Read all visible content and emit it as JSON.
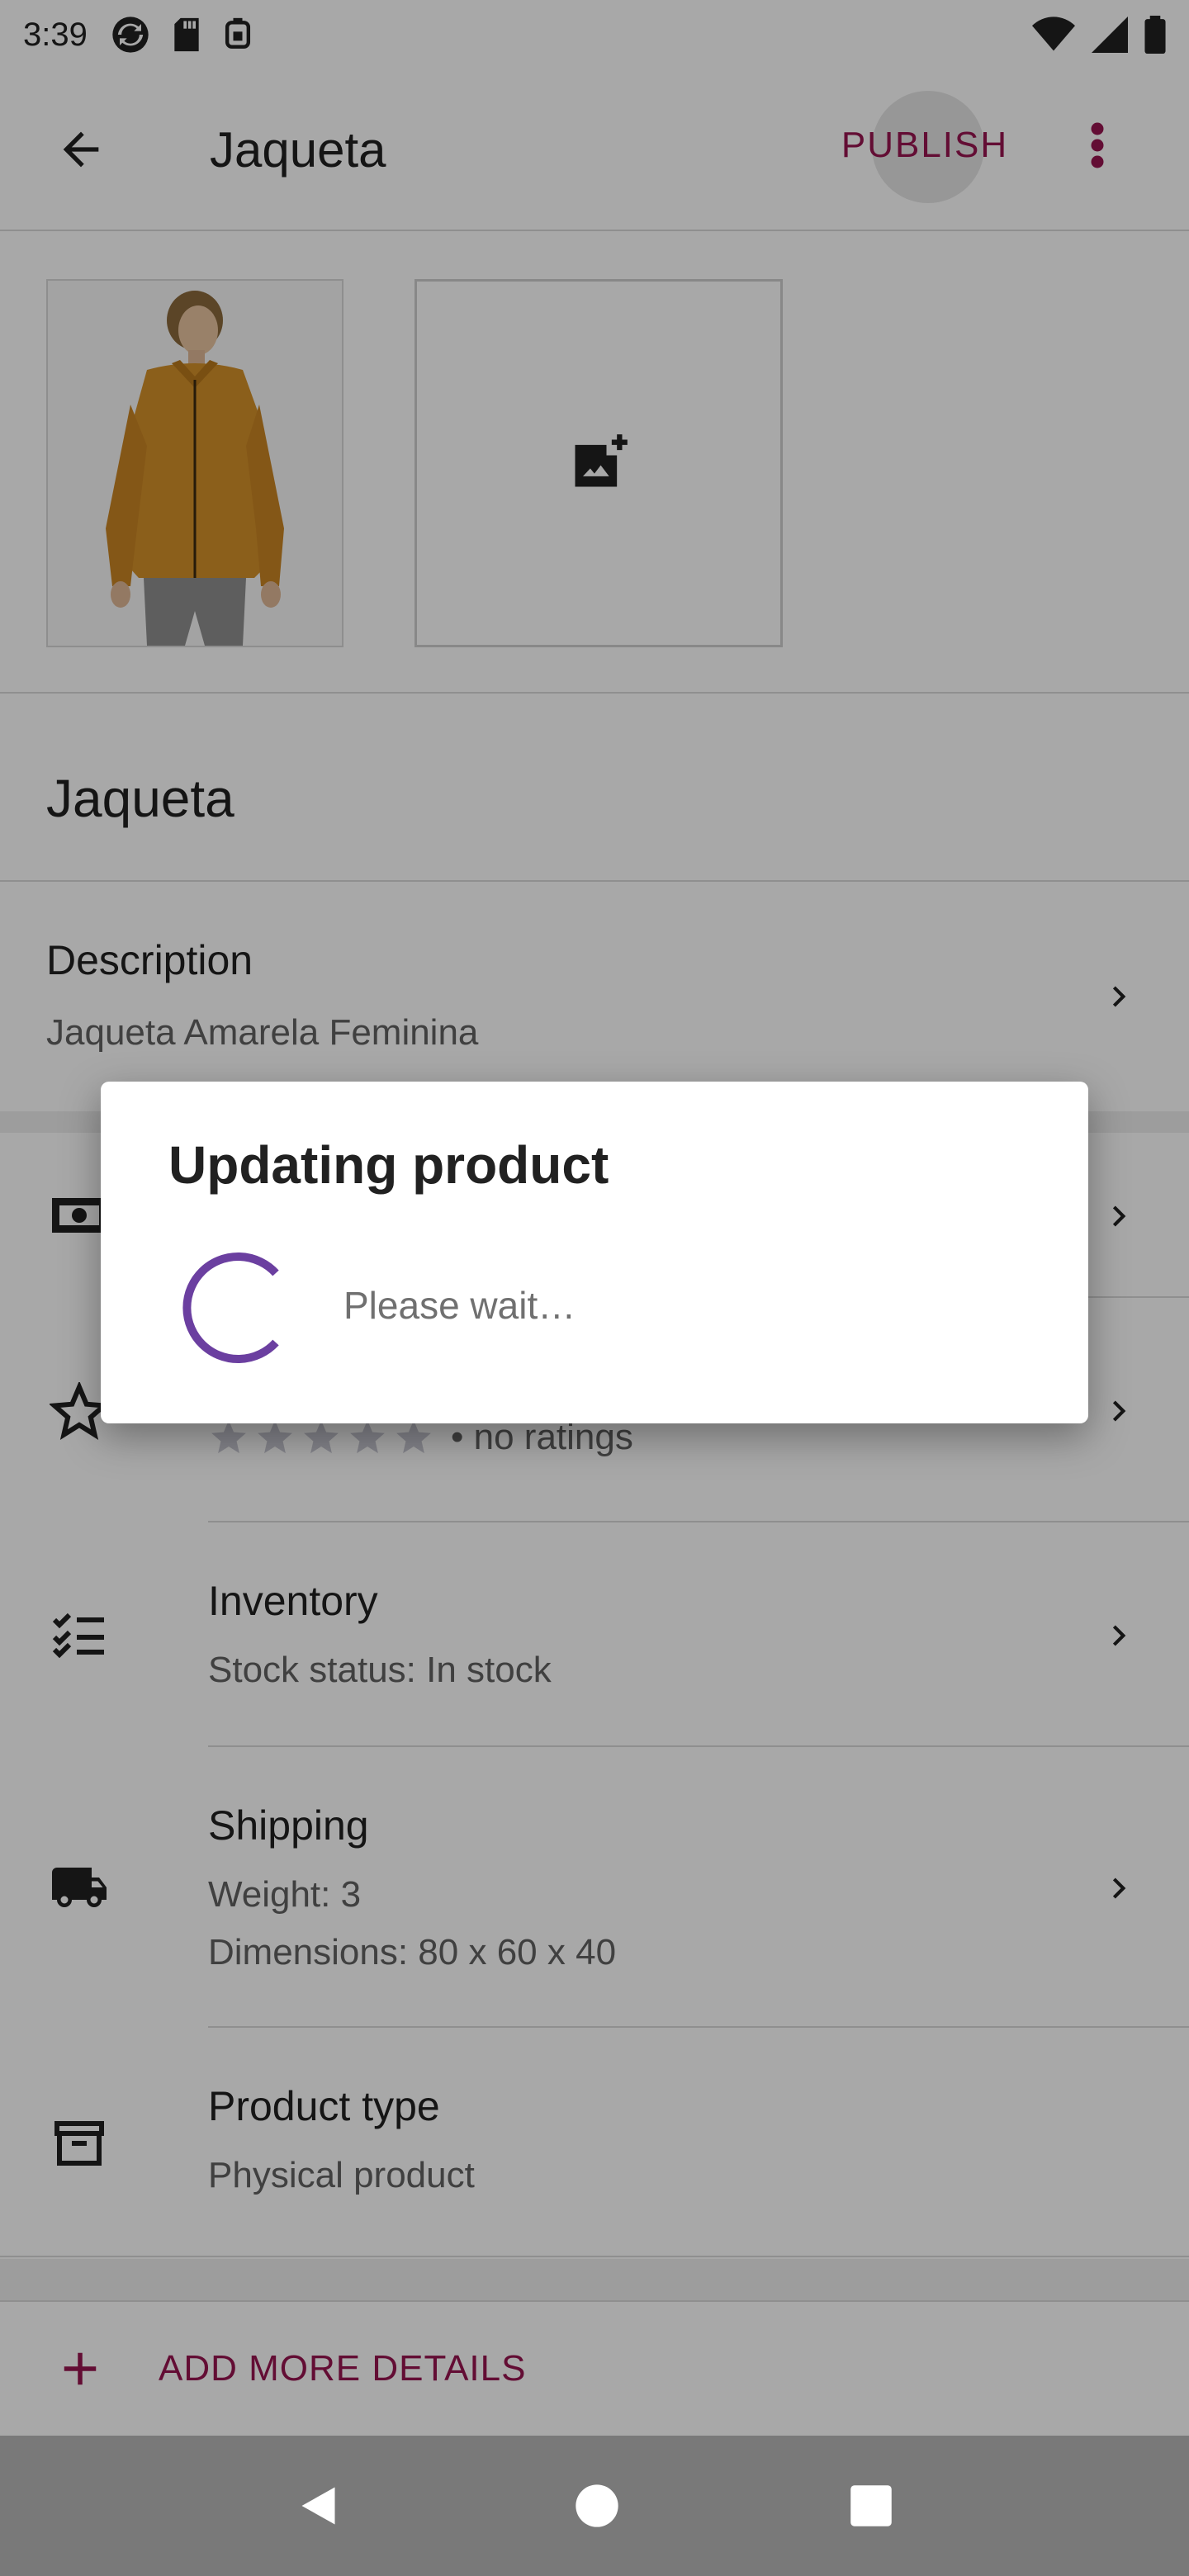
{
  "status_bar": {
    "time": "3:39",
    "icons": [
      "sync-icon",
      "sd-card-icon",
      "vpn-icon",
      "wifi-icon",
      "signal-icon",
      "battery-icon"
    ]
  },
  "app_bar": {
    "title": "Jaqueta",
    "publish_label": "PUBLISH",
    "back_icon": "arrow-back-icon",
    "more_icon": "more-vert-icon"
  },
  "images": {
    "add_image_icon": "add-photo-icon"
  },
  "product": {
    "name": "Jaqueta"
  },
  "description": {
    "title": "Description",
    "value": "Jaqueta Amarela Feminina"
  },
  "reviews": {
    "ratings_text": "• no ratings",
    "star_count": 5,
    "rating_value": 0
  },
  "inventory": {
    "title": "Inventory",
    "status": "Stock status: In stock"
  },
  "shipping": {
    "title": "Shipping",
    "weight": "Weight: 3",
    "dimensions": "Dimensions: 80 x 60 x 40"
  },
  "product_type": {
    "title": "Product type",
    "value": "Physical product"
  },
  "add_more": {
    "label": "ADD MORE DETAILS"
  },
  "dialog": {
    "title": "Updating product",
    "message": "Please wait…"
  },
  "colors": {
    "accent": "#96154f",
    "spinner": "#6b3fa0",
    "scrim": "rgba(0,0,0,0.34)"
  }
}
